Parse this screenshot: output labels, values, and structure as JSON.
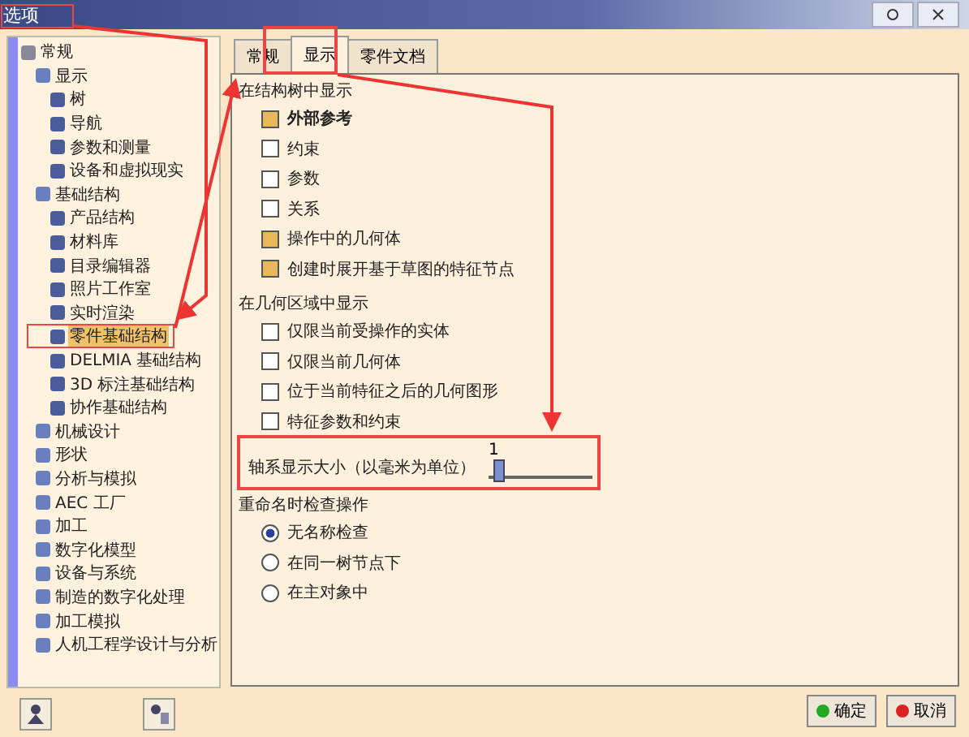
{
  "window": {
    "title": "选项"
  },
  "tree": [
    {
      "label": "常规",
      "selected": false,
      "children": [
        {
          "label": "显示",
          "selected": false,
          "children": [
            {
              "label": "树",
              "selected": false
            },
            {
              "label": "导航",
              "selected": false
            },
            {
              "label": "参数和测量",
              "selected": false
            },
            {
              "label": "设备和虚拟现实",
              "selected": false
            }
          ]
        },
        {
          "label": "基础结构",
          "selected": false,
          "children": [
            {
              "label": "产品结构",
              "selected": false
            },
            {
              "label": "材料库",
              "selected": false
            },
            {
              "label": "目录编辑器",
              "selected": false
            },
            {
              "label": "照片工作室",
              "selected": false
            },
            {
              "label": "实时渲染",
              "selected": false
            },
            {
              "label": "零件基础结构",
              "selected": true
            },
            {
              "label": "DELMIA 基础结构",
              "selected": false
            },
            {
              "label": "3D 标注基础结构",
              "selected": false
            },
            {
              "label": "协作基础结构",
              "selected": false
            }
          ]
        },
        {
          "label": "机械设计",
          "selected": false
        },
        {
          "label": "形状",
          "selected": false
        },
        {
          "label": "分析与模拟",
          "selected": false
        },
        {
          "label": "AEC 工厂",
          "selected": false
        },
        {
          "label": "加工",
          "selected": false
        },
        {
          "label": "数字化模型",
          "selected": false
        },
        {
          "label": "设备与系统",
          "selected": false
        },
        {
          "label": "制造的数字化处理",
          "selected": false
        },
        {
          "label": "加工模拟",
          "selected": false
        },
        {
          "label": "人机工程学设计与分析",
          "selected": false
        }
      ]
    }
  ],
  "tabs": [
    {
      "label": "常规",
      "selected": false
    },
    {
      "label": "显示",
      "selected": true
    },
    {
      "label": "零件文档",
      "selected": false
    }
  ],
  "groups": [
    {
      "title": "在结构树中显示",
      "items": [
        {
          "kind": "checkbox",
          "label": "外部参考",
          "checked": true
        },
        {
          "kind": "checkbox",
          "label": "约束",
          "checked": false
        },
        {
          "kind": "checkbox",
          "label": "参数",
          "checked": false
        },
        {
          "kind": "checkbox",
          "label": "关系",
          "checked": false
        },
        {
          "kind": "checkbox",
          "label": "操作中的几何体",
          "checked": true
        },
        {
          "kind": "checkbox",
          "label": "创建时展开基于草图的特征节点",
          "checked": true
        }
      ]
    },
    {
      "title": "在几何区域中显示",
      "items": [
        {
          "kind": "checkbox",
          "label": "仅限当前受操作的实体",
          "checked": false
        },
        {
          "kind": "checkbox",
          "label": "仅限当前几何体",
          "checked": false
        },
        {
          "kind": "checkbox",
          "label": "位于当前特征之后的几何图形",
          "checked": false
        },
        {
          "kind": "checkbox",
          "label": "特征参数和约束",
          "checked": false
        },
        {
          "kind": "slider",
          "label": "轴系显示大小（以毫米为单位）",
          "reading": "1",
          "level": 0.05
        }
      ]
    },
    {
      "title": "重命名时检查操作",
      "items": [
        {
          "kind": "radio",
          "label": "无名称检查",
          "selected": true
        },
        {
          "kind": "radio",
          "label": "在同一树节点下",
          "selected": false
        },
        {
          "kind": "radio",
          "label": "在主对象中",
          "selected": false
        }
      ]
    }
  ],
  "buttons": [
    {
      "label": "确定",
      "kind": "ok"
    },
    {
      "label": "取消",
      "kind": "cancel"
    }
  ]
}
